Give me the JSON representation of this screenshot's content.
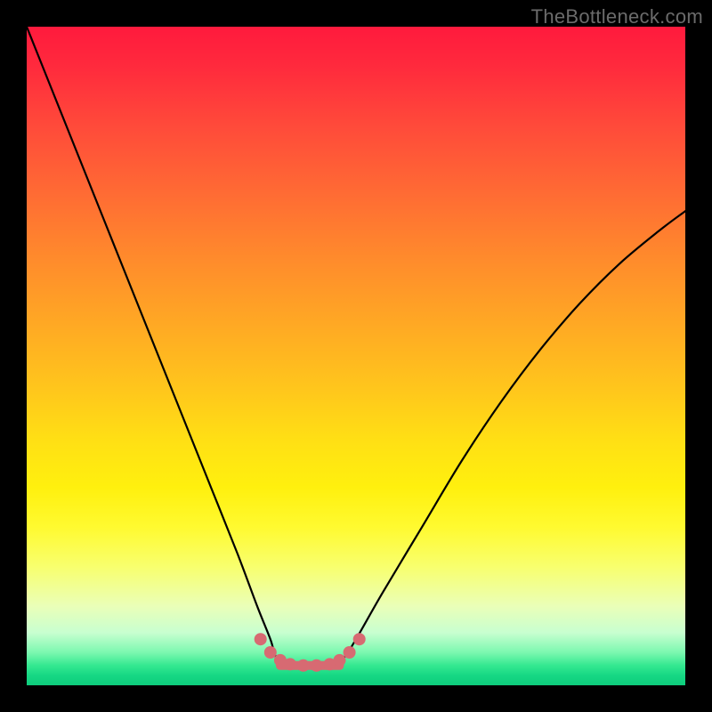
{
  "watermark": "TheBottleneck.com",
  "colors": {
    "background_frame": "#000000",
    "gradient_top": "#ff1a3d",
    "gradient_mid": "#ffe014",
    "gradient_bottom": "#0ecc7c",
    "curve": "#000000",
    "marker_fill": "#d76a72"
  },
  "chart_data": {
    "type": "line",
    "title": "",
    "xlabel": "",
    "ylabel": "",
    "xlim": [
      0,
      100
    ],
    "ylim": [
      0,
      100
    ],
    "grid": false,
    "legend": false,
    "note": "x and y are in percent of plot area (0 at left/bottom, 100 at right/top). The curve is a V-shaped bottleneck profile: steep descent on the left, a flat minimum plateau near x≈38–48 at y≈3, then a gentler ascent on the right.",
    "series": [
      {
        "name": "bottleneck-curve",
        "x": [
          0,
          4,
          8,
          12,
          16,
          20,
          24,
          28,
          32,
          35,
          37,
          38,
          40,
          42,
          44,
          46,
          48,
          50,
          54,
          60,
          66,
          72,
          78,
          84,
          90,
          96,
          100
        ],
        "y": [
          100,
          90,
          80,
          70,
          60,
          50,
          40,
          30,
          20,
          12,
          7,
          4,
          3,
          3,
          3,
          3,
          4,
          7,
          14,
          24,
          34,
          43,
          51,
          58,
          64,
          69,
          72
        ]
      }
    ],
    "markers": {
      "name": "plateau-markers",
      "color": "#d76a72",
      "x": [
        35.5,
        37.0,
        38.5,
        40.0,
        42.0,
        44.0,
        46.0,
        47.5,
        49.0,
        50.5
      ],
      "y": [
        7.0,
        5.0,
        3.8,
        3.2,
        3.0,
        3.0,
        3.2,
        3.8,
        5.0,
        7.0
      ]
    },
    "plateau_segment": {
      "x_start": 38.5,
      "x_end": 47.5,
      "y": 3.0
    }
  }
}
